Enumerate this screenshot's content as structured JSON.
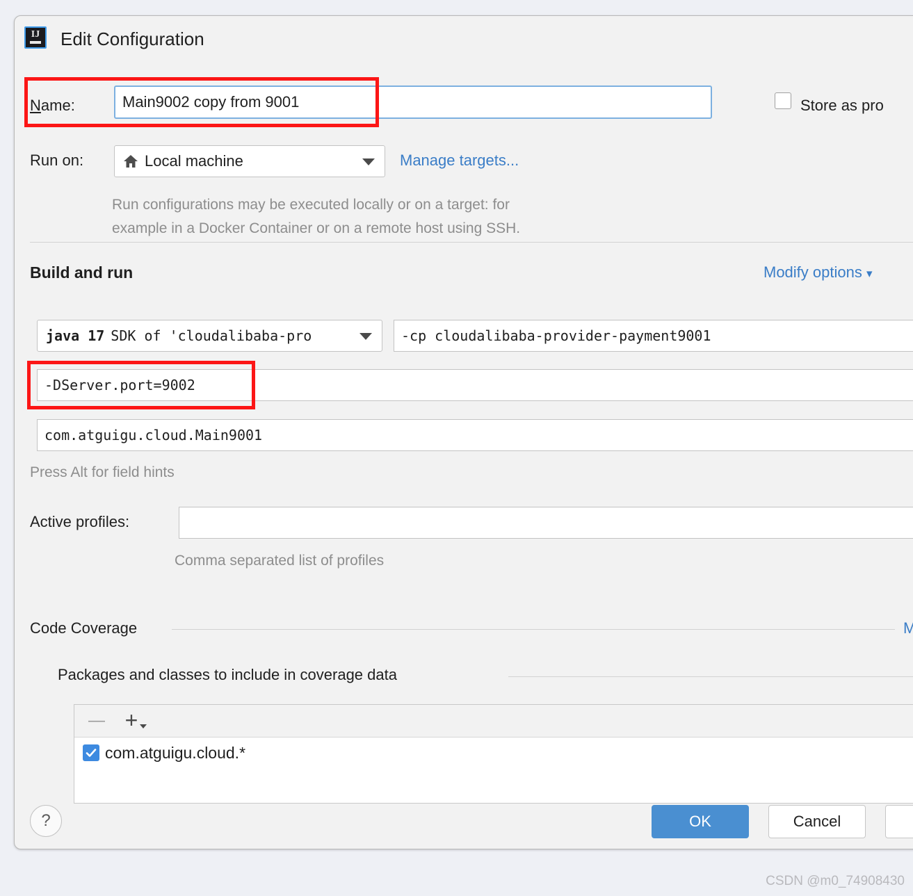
{
  "window": {
    "title": "Edit Configuration",
    "app_icon": "intellij-idea-icon"
  },
  "name_row": {
    "label": "Name:",
    "label_mnemonic": "N",
    "value": "Main9002 copy from 9001",
    "store_as_project_file": {
      "label": "Store as pro",
      "checked": false
    }
  },
  "run_on_row": {
    "label": "Run on:",
    "target": "Local machine",
    "target_icon": "home-icon",
    "manage_targets_link": "Manage targets...",
    "description_line1": "Run configurations may be executed locally or on a target: for",
    "description_line2": "example in a Docker Container or on a remote host using SSH."
  },
  "build_and_run": {
    "section_title": "Build and run",
    "modify_options_link": "Modify options",
    "jdk": {
      "name": "java 17",
      "detail": "SDK of 'cloudalibaba-pro"
    },
    "shorten_cmdline_value": "-cp cloudalibaba-provider-payment9001",
    "vm_options_value": "-DServer.port=9002",
    "main_class_value": "com.atguigu.cloud.Main9001",
    "field_hint": "Press Alt for field hints"
  },
  "active_profiles": {
    "label": "Active profiles:",
    "value": "",
    "hint": "Comma separated list of profiles"
  },
  "code_coverage": {
    "section_title": "Code Coverage",
    "subsection_title": "Packages and classes to include in coverage data",
    "toolbar": {
      "remove_label": "—",
      "add_label": "+"
    },
    "entries": [
      {
        "checked": true,
        "pattern": "com.atguigu.cloud.*"
      }
    ]
  },
  "footer": {
    "help_label": "?",
    "ok_label": "OK",
    "cancel_label": "Cancel"
  },
  "watermark": "CSDN @m0_74908430",
  "colors": {
    "accent_blue": "#4a8fd1",
    "link_blue": "#3a7dc7",
    "annotation_red": "#fc1616",
    "dialog_bg": "#f2f2f2",
    "page_bg": "#eef0f5"
  }
}
